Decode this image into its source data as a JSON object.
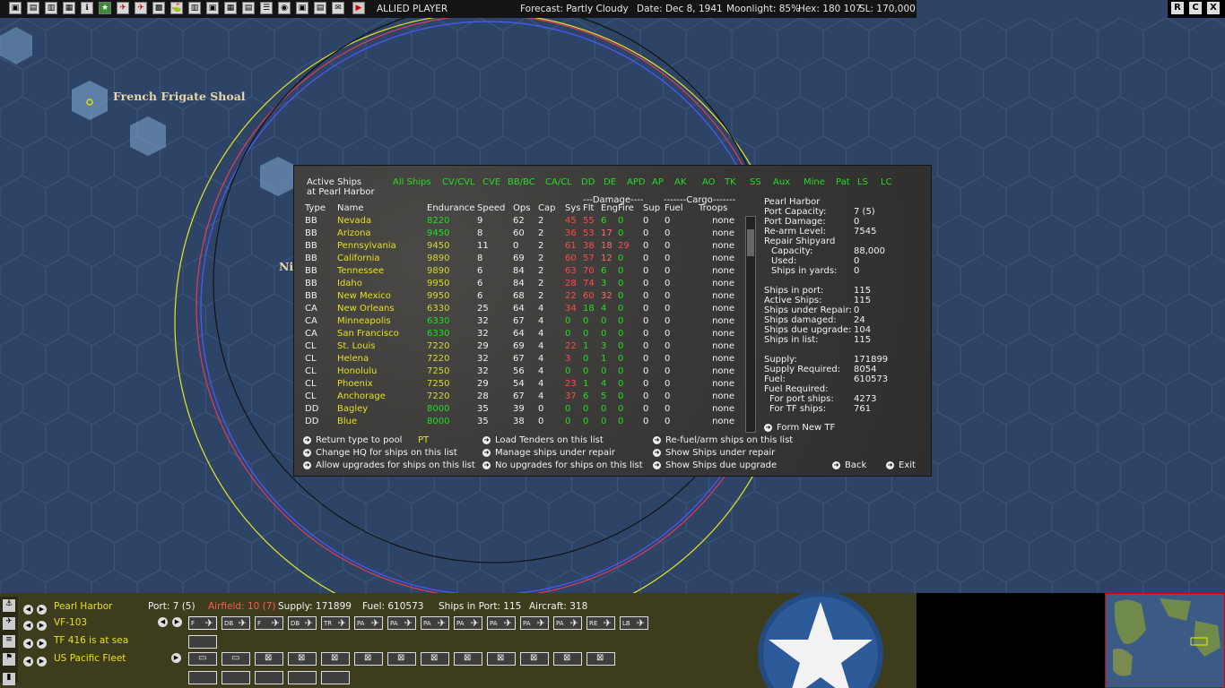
{
  "topbar": {
    "player": "ALLIED PLAYER",
    "forecast": "Forecast: Partly Cloudy",
    "date": "Date: Dec 8, 1941",
    "moonlight": "Moonlight: 85%",
    "hex": "Hex: 180 107",
    "sl": "SL: 170,000",
    "window_buttons": [
      "R",
      "C",
      "X"
    ]
  },
  "map": {
    "labels": [
      "French Frigate Shoal",
      "Nil"
    ]
  },
  "dialog": {
    "title_line1": "Active Ships",
    "title_line2": "at Pearl Harbor",
    "filters": [
      "All Ships",
      "CV/CVL",
      "CVE",
      "BB/BC",
      "CA/CL",
      "DD",
      "DE",
      "APD",
      "AP",
      "AK",
      "AO",
      "TK",
      "SS",
      "Aux",
      "Mine",
      "Pat",
      "LS",
      "LC"
    ],
    "group_damage": "---Damage----",
    "group_cargo": "-------Cargo-------",
    "columns": [
      "Type",
      "Name",
      "Endurance",
      "Speed",
      "Ops",
      "Cap",
      "Sys",
      "Flt",
      "Eng",
      "Fire",
      "Sup",
      "Fuel",
      "Troops"
    ],
    "ships": [
      {
        "type": "BB",
        "name": "Nevada",
        "endurance": "8220",
        "speed": "9",
        "ops": "62",
        "cap": "2",
        "sys": "45",
        "flt": "55",
        "eng": "6",
        "fire": "0",
        "sup": "0",
        "fuel": "0",
        "troops": "none"
      },
      {
        "type": "BB",
        "name": "Arizona",
        "endurance": "9450",
        "speed": "8",
        "ops": "60",
        "cap": "2",
        "sys": "36",
        "flt": "53",
        "eng": "17",
        "fire": "0",
        "sup": "0",
        "fuel": "0",
        "troops": "none"
      },
      {
        "type": "BB",
        "name": "Pennsylvania",
        "endurance": "9450",
        "speed": "11",
        "ops": "0",
        "cap": "2",
        "sys": "61",
        "flt": "38",
        "eng": "18",
        "fire": "29",
        "sup": "0",
        "fuel": "0",
        "troops": "none"
      },
      {
        "type": "BB",
        "name": "California",
        "endurance": "9890",
        "speed": "8",
        "ops": "69",
        "cap": "2",
        "sys": "60",
        "flt": "57",
        "eng": "12",
        "fire": "0",
        "sup": "0",
        "fuel": "0",
        "troops": "none"
      },
      {
        "type": "BB",
        "name": "Tennessee",
        "endurance": "9890",
        "speed": "6",
        "ops": "84",
        "cap": "2",
        "sys": "63",
        "flt": "70",
        "eng": "6",
        "fire": "0",
        "sup": "0",
        "fuel": "0",
        "troops": "none"
      },
      {
        "type": "BB",
        "name": "Idaho",
        "endurance": "9950",
        "speed": "6",
        "ops": "84",
        "cap": "2",
        "sys": "28",
        "flt": "74",
        "eng": "3",
        "fire": "0",
        "sup": "0",
        "fuel": "0",
        "troops": "none"
      },
      {
        "type": "BB",
        "name": "New Mexico",
        "endurance": "9950",
        "speed": "6",
        "ops": "68",
        "cap": "2",
        "sys": "22",
        "flt": "60",
        "eng": "32",
        "fire": "0",
        "sup": "0",
        "fuel": "0",
        "troops": "none"
      },
      {
        "type": "CA",
        "name": "New Orleans",
        "endurance": "6330",
        "speed": "25",
        "ops": "64",
        "cap": "4",
        "sys": "34",
        "flt": "18",
        "eng": "4",
        "fire": "0",
        "sup": "0",
        "fuel": "0",
        "troops": "none"
      },
      {
        "type": "CA",
        "name": "Minneapolis",
        "endurance": "6330",
        "speed": "32",
        "ops": "67",
        "cap": "4",
        "sys": "0",
        "flt": "0",
        "eng": "0",
        "fire": "0",
        "sup": "0",
        "fuel": "0",
        "troops": "none"
      },
      {
        "type": "CA",
        "name": "San Francisco",
        "endurance": "6330",
        "speed": "32",
        "ops": "64",
        "cap": "4",
        "sys": "0",
        "flt": "0",
        "eng": "0",
        "fire": "0",
        "sup": "0",
        "fuel": "0",
        "troops": "none"
      },
      {
        "type": "CL",
        "name": "St. Louis",
        "endurance": "7220",
        "speed": "29",
        "ops": "69",
        "cap": "4",
        "sys": "22",
        "flt": "1",
        "eng": "3",
        "fire": "0",
        "sup": "0",
        "fuel": "0",
        "troops": "none"
      },
      {
        "type": "CL",
        "name": "Helena",
        "endurance": "7220",
        "speed": "32",
        "ops": "67",
        "cap": "4",
        "sys": "3",
        "flt": "0",
        "eng": "1",
        "fire": "0",
        "sup": "0",
        "fuel": "0",
        "troops": "none"
      },
      {
        "type": "CL",
        "name": "Honolulu",
        "endurance": "7250",
        "speed": "32",
        "ops": "56",
        "cap": "4",
        "sys": "0",
        "flt": "0",
        "eng": "0",
        "fire": "0",
        "sup": "0",
        "fuel": "0",
        "troops": "none"
      },
      {
        "type": "CL",
        "name": "Phoenix",
        "endurance": "7250",
        "speed": "29",
        "ops": "54",
        "cap": "4",
        "sys": "23",
        "flt": "1",
        "eng": "4",
        "fire": "0",
        "sup": "0",
        "fuel": "0",
        "troops": "none"
      },
      {
        "type": "CL",
        "name": "Anchorage",
        "endurance": "7220",
        "speed": "28",
        "ops": "67",
        "cap": "4",
        "sys": "37",
        "flt": "6",
        "eng": "5",
        "fire": "0",
        "sup": "0",
        "fuel": "0",
        "troops": "none"
      },
      {
        "type": "DD",
        "name": "Bagley",
        "endurance": "8000",
        "speed": "35",
        "ops": "39",
        "cap": "0",
        "sys": "0",
        "flt": "0",
        "eng": "0",
        "fire": "0",
        "sup": "0",
        "fuel": "0",
        "troops": "none"
      },
      {
        "type": "DD",
        "name": "Blue",
        "endurance": "8000",
        "speed": "35",
        "ops": "38",
        "cap": "0",
        "sys": "0",
        "flt": "0",
        "eng": "0",
        "fire": "0",
        "sup": "0",
        "fuel": "0",
        "troops": "none"
      }
    ],
    "info": {
      "location": "Pearl Harbor",
      "rows": [
        {
          "label": "Port Capacity:",
          "value": "7 (5)"
        },
        {
          "label": "Port Damage:",
          "value": "0"
        },
        {
          "label": "Re-arm Level:",
          "value": "7545"
        },
        {
          "label": "Repair Shipyard",
          "value": ""
        },
        {
          "label": "Capacity:",
          "value": "88,000"
        },
        {
          "label": "Used:",
          "value": "0"
        },
        {
          "label": "Ships in yards:",
          "value": "0"
        },
        {
          "label": "Ships in port:",
          "value": "115"
        },
        {
          "label": "Active Ships:",
          "value": "115"
        },
        {
          "label": "Ships under Repair:",
          "value": "0"
        },
        {
          "label": "Ships damaged:",
          "value": "24"
        },
        {
          "label": "Ships due upgrade:",
          "value": "104"
        },
        {
          "label": "Ships in list:",
          "value": "115"
        },
        {
          "label": "Supply:",
          "value": "171899"
        },
        {
          "label": "Supply Required:",
          "value": "8054"
        },
        {
          "label": "Fuel:",
          "value": "610573"
        },
        {
          "label": "Fuel Required:",
          "value": ""
        },
        {
          "label": "For port ships:",
          "value": "4273"
        },
        {
          "label": "For TF ships:",
          "value": "761"
        }
      ]
    },
    "form_new_tf": "Form New TF",
    "actions": {
      "return_pool": "Return type to pool",
      "return_pool_type": "PT",
      "change_hq": "Change HQ for ships on this list",
      "allow_upgrades": "Allow upgrades for ships on this list",
      "load_tenders": "Load Tenders on this list",
      "manage_repair": "Manage ships under repair",
      "no_upgrades": "No upgrades for ships on this list",
      "refuel": "Re-fuel/arm ships on this list",
      "show_repair": "Show Ships under repair",
      "show_upgrade": "Show Ships due upgrade",
      "back": "Back",
      "exit": "Exit"
    }
  },
  "bottombar": {
    "base": "Pearl Harbor",
    "port": "Port: 7 (5)",
    "airfield": "Airfield: 10 (7)",
    "supply": "Supply: 171899",
    "fuel": "Fuel: 610573",
    "ships_in_port": "Ships in Port: 115",
    "aircraft": "Aircraft: 318",
    "air_unit": "VF-103",
    "task_force": "TF 416 is at sea",
    "command": "US Pacific Fleet",
    "aircraft_slots": [
      "F",
      "DB",
      "F",
      "DB",
      "TR",
      "PA",
      "PA",
      "PA",
      "PA",
      "PA",
      "PA",
      "PA",
      "RE",
      "LB"
    ]
  },
  "colors": {
    "ocean": "#2d4466",
    "dialog_bg": "#3b3a38",
    "yellow_text": "#e8e020",
    "green_text": "#25dd25",
    "red_text": "#ff4a4a"
  }
}
